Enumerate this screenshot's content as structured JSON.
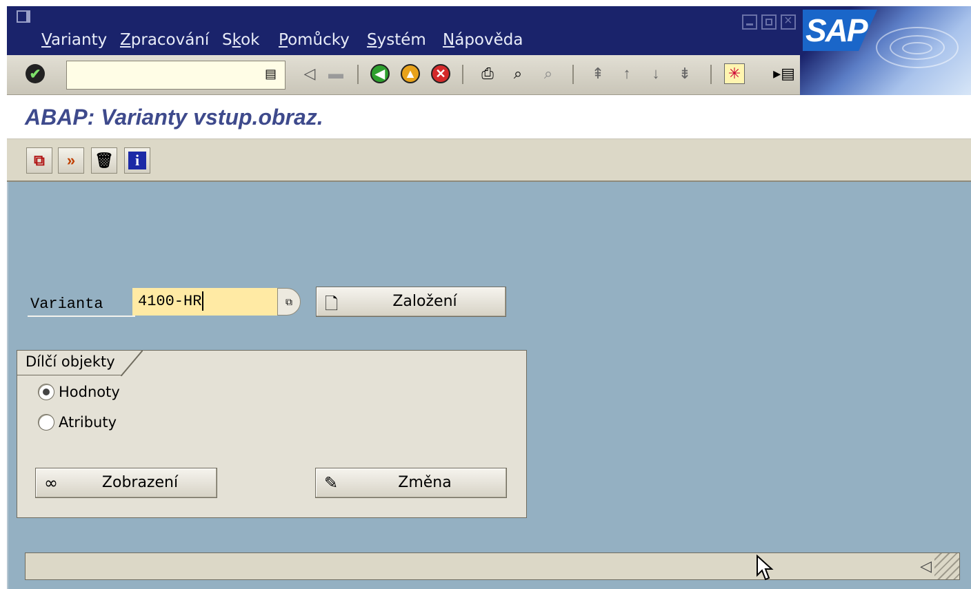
{
  "menubar": {
    "items": [
      {
        "pre": "",
        "acc": "V",
        "rest": "arianty"
      },
      {
        "pre": "",
        "acc": "Z",
        "rest": "pracování"
      },
      {
        "pre": "S",
        "acc": "k",
        "rest": "ok"
      },
      {
        "pre": "",
        "acc": "P",
        "rest": "omůcky"
      },
      {
        "pre": "",
        "acc": "S",
        "rest": "ystém"
      },
      {
        "pre": "",
        "acc": "N",
        "rest": "ápověda"
      }
    ],
    "logo_text": "SAP"
  },
  "toolbar": {
    "command_value": "",
    "icons": [
      "enter-icon",
      "command-list-icon",
      "back-triangle-icon",
      "save-icon",
      "back-icon",
      "exit-icon",
      "cancel-icon",
      "print-icon",
      "find-icon",
      "find-next-icon",
      "first-page-icon",
      "previous-page-icon",
      "next-page-icon",
      "last-page-icon",
      "create-session-icon",
      "generate-shortcut-icon"
    ]
  },
  "title": "ABAP: Varianty vstup.obraz.",
  "app_toolbar": {
    "buttons": [
      "copy-icon",
      "rename-icon",
      "delete-icon",
      "info-icon"
    ]
  },
  "form": {
    "variant_label": "Varianta",
    "variant_value": "4100-HR",
    "create_button": "Založení"
  },
  "group": {
    "title": "Dílčí objekty",
    "radio_values": "Hodnoty",
    "radio_attributes": "Atributy",
    "selected": "Hodnoty",
    "display_button": "Zobrazení",
    "change_button": "Změna"
  },
  "status": {
    "message": ""
  },
  "colors": {
    "menubar": "#1a236b",
    "screen_bg": "#94b0c2",
    "title_text": "#3e4a8c",
    "field_bg": "#ffeaa4"
  }
}
